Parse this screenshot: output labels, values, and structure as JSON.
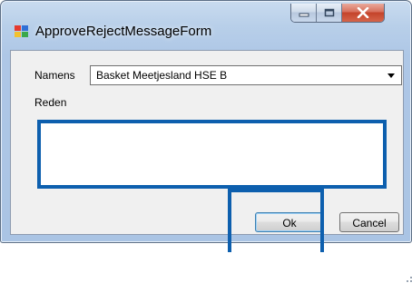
{
  "window": {
    "title": "ApproveRejectMessageForm",
    "icon": "application-form-icon",
    "caption_buttons": [
      "minimize-icon",
      "maximize-icon",
      "close-icon"
    ]
  },
  "form": {
    "namens_label": "Namens",
    "namens_selected": "Basket Meetjesland HSE B",
    "reden_label": "Reden",
    "reden_value": ""
  },
  "buttons": {
    "ok_label": "Ok",
    "cancel_label": "Cancel"
  },
  "colors": {
    "highlight": "#0d5fae",
    "close_button": "#c4432a",
    "titlebar": "#b8cfe9"
  }
}
